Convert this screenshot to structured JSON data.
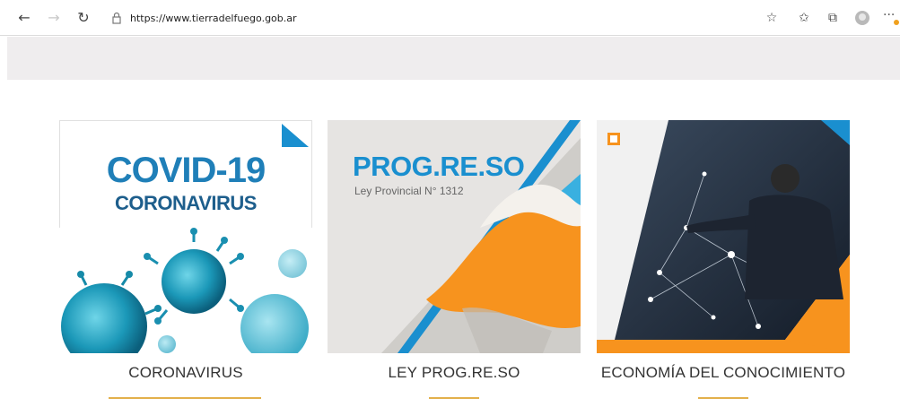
{
  "browser": {
    "url": "https://www.tierradelfuego.gob.ar",
    "icons": [
      "back-icon",
      "forward-icon",
      "refresh-icon",
      "lock-icon",
      "favorite-add-icon",
      "favorites-icon",
      "collections-icon",
      "profile-icon",
      "more-icon"
    ]
  },
  "cards": [
    {
      "title_line1": "COVID-19",
      "title_line2": "CORONAVIRUS",
      "label": "CORONAVIRUS"
    },
    {
      "title": "PROG.RE.SO",
      "subtitle": "Ley Provincial N° 1312",
      "label": "LEY PROG.RE.SO"
    },
    {
      "label": "ECONOMÍA DEL CONOCIMIENTO"
    }
  ],
  "colors": {
    "accent_blue": "#1a8fcf",
    "underline": "#e3b04b",
    "orange": "#f7931e"
  }
}
